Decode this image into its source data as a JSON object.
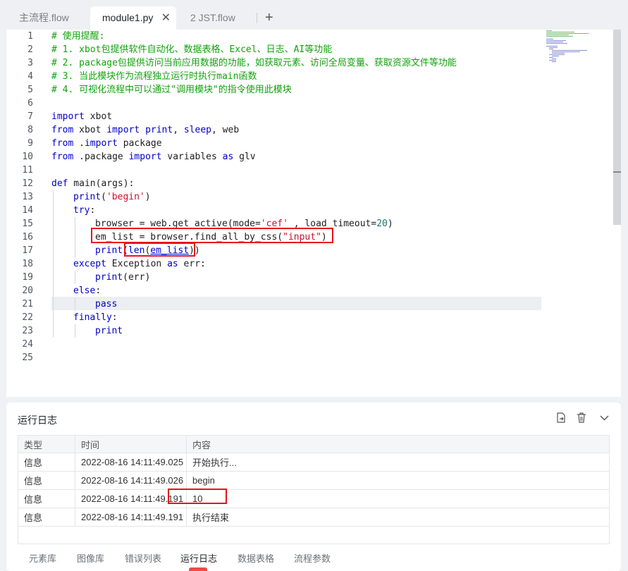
{
  "tabs": [
    {
      "label": "主流程.flow",
      "active": false
    },
    {
      "label": "module1.py",
      "active": true,
      "close": "✕"
    },
    {
      "label": "2 JST.flow",
      "active": false
    }
  ],
  "add_tab_icon": "plus-icon",
  "line_numbers": [
    "1",
    "2",
    "3",
    "4",
    "5",
    "6",
    "7",
    "8",
    "9",
    "10",
    "11",
    "12",
    "13",
    "14",
    "15",
    "16",
    "17",
    "18",
    "19",
    "20",
    "21",
    "22",
    "23",
    "24",
    "25"
  ],
  "code": {
    "l1": "# 使用提醒:",
    "l2": "# 1. xbot包提供软件自动化、数据表格、Excel、日志、AI等功能",
    "l3": "# 2. package包提供访问当前应用数据的功能，如获取元素、访问全局变量、获取资源文件等功能",
    "l4": "# 3. 当此模块作为流程独立运行时执行main函数",
    "l5": "# 4. 可视化流程中可以通过\"调用模块\"的指令使用此模块",
    "l7_kw": "import",
    "l7_rest": " xbot",
    "l8_a": "from",
    "l8_b": " xbot ",
    "l8_c": "import",
    "l8_d": " print",
    "l8_e": ", ",
    "l8_f": "sleep",
    "l8_g": ", web",
    "l9_a": "from",
    "l9_b": " .",
    "l9_c": "import",
    "l9_d": " package",
    "l10_a": "from",
    "l10_b": " .package ",
    "l10_c": "import",
    "l10_d": " variables ",
    "l10_e": "as",
    "l10_f": " glv",
    "l12_a": "def",
    "l12_b": " main(args):",
    "l13_a": "print",
    "l13_b": "(",
    "l13_c": "'begin'",
    "l13_d": ")",
    "l14_a": "try",
    "l14_b": ":",
    "l15_a": "browser = web.get_active(mode=",
    "l15_b": "'cef'",
    "l15_c": " , load_timeout=",
    "l15_d": "20",
    "l15_e": ")",
    "l16_a": "em_list = browser.find_all_by_css(",
    "l16_b": "\"input\"",
    "l16_c": ")",
    "l17_a": "print",
    "l17_b": "(",
    "l17_c": "len",
    "l17_d": "(",
    "l17_e": "em_list",
    "l17_f": "))",
    "l18_a": "except",
    "l18_b": " Exception ",
    "l18_c": "as",
    "l18_d": " err:",
    "l19_a": "print",
    "l19_b": "(err)",
    "l20_a": "else",
    "l20_b": ":",
    "l21_a": "pass",
    "l22_a": "finally",
    "l22_b": ":",
    "l23_a": "print"
  },
  "log": {
    "title": "运行日志",
    "headers": [
      "类型",
      "时间",
      "内容"
    ],
    "rows": [
      {
        "type": "信息",
        "time": "2022-08-16 14:11:49.025",
        "content": "开始执行..."
      },
      {
        "type": "信息",
        "time": "2022-08-16 14:11:49.026",
        "content": "begin"
      },
      {
        "type": "信息",
        "time": "2022-08-16 14:11:49.191",
        "content": "10"
      },
      {
        "type": "信息",
        "time": "2022-08-16 14:11:49.191",
        "content": "执行结束"
      }
    ],
    "icons": [
      "export-icon",
      "trash-icon",
      "chevron-down-icon"
    ]
  },
  "bottom_tabs": [
    "元素库",
    "图像库",
    "错误列表",
    "运行日志",
    "数据表格",
    "流程参数"
  ],
  "active_bottom_tab": "运行日志",
  "colors": {
    "keyword": "#0000c8",
    "comment": "#13a10e",
    "string": "#c8102e",
    "number": "#0f7b6c",
    "highlight_box": "#e5141b"
  }
}
